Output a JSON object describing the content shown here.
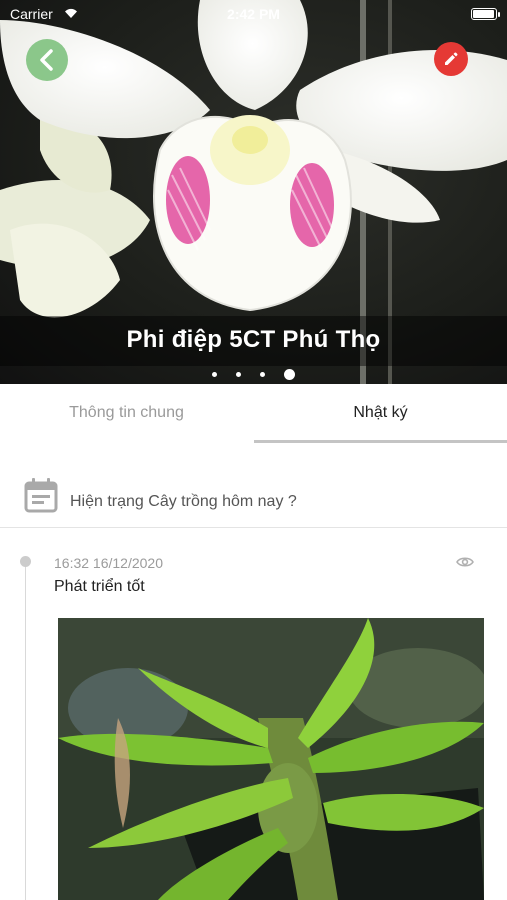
{
  "status_bar": {
    "carrier": "Carrier",
    "time": "2:42 PM"
  },
  "hero": {
    "title": "Phi điệp 5CT Phú Thọ",
    "page_count": 4,
    "active_page": 4
  },
  "icons": {
    "back": "chevron-left-icon",
    "edit": "pencil-icon",
    "calendar": "calendar-icon",
    "view": "eye-icon"
  },
  "colors": {
    "back_button": "#78be78",
    "edit_button": "#e53935",
    "accent_underline": "#c4c4c4"
  },
  "tabs": [
    {
      "label": "Thông tin chung",
      "active": false
    },
    {
      "label": "Nhật ký",
      "active": true
    }
  ],
  "diary": {
    "question": "Hiện trạng Cây trồng hôm nay ?",
    "entries": [
      {
        "timestamp": "16:32 16/12/2020",
        "text": "Phát triển tốt"
      }
    ]
  }
}
